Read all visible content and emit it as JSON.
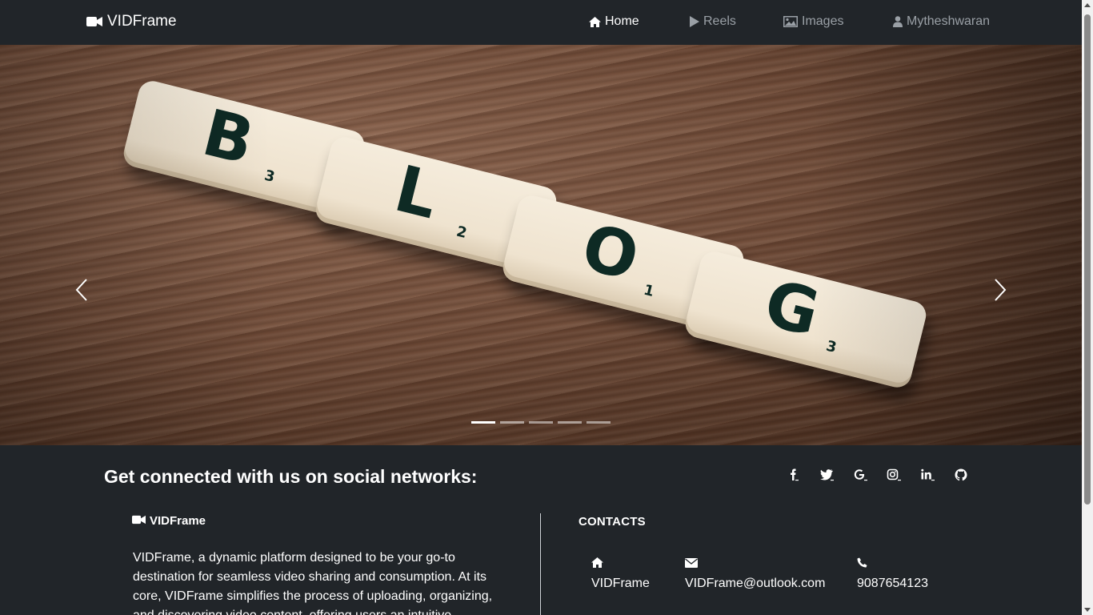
{
  "navbar": {
    "brand": "VIDFrame",
    "brand_icon": "video-camera-icon",
    "items": [
      {
        "label": "Home",
        "icon": "home-icon",
        "active": true
      },
      {
        "label": "Reels",
        "icon": "play-icon",
        "active": false
      },
      {
        "label": "Images",
        "icon": "image-icon",
        "active": false
      },
      {
        "label": "Mytheshwaran",
        "icon": "user-icon",
        "active": false
      }
    ]
  },
  "carousel": {
    "tiles": [
      {
        "letter": "B",
        "sub": "3"
      },
      {
        "letter": "L",
        "sub": "2"
      },
      {
        "letter": "O",
        "sub": "1"
      },
      {
        "letter": "G",
        "sub": "3"
      }
    ],
    "indicator_count": 5,
    "active_index": 0
  },
  "footer": {
    "social_title": "Get connected with us on social networks:",
    "social": [
      {
        "name": "facebook-icon",
        "glyph": "f"
      },
      {
        "name": "twitter-icon",
        "glyph": "t"
      },
      {
        "name": "google-icon",
        "glyph": "G"
      },
      {
        "name": "instagram-icon",
        "glyph": "◎"
      },
      {
        "name": "linkedin-icon",
        "glyph": "in"
      },
      {
        "name": "github-icon",
        "glyph": "●"
      }
    ],
    "brand": "VIDFrame",
    "about": "VIDFrame, a dynamic platform designed to be your go-to destination for seamless video sharing and consumption. At its core, VIDFrame simplifies the process of uploading, organizing, and discovering video content, offering users an intuitive",
    "contacts_head": "CONTACTS",
    "contacts": [
      {
        "icon": "home-icon",
        "text": "VIDFrame"
      },
      {
        "icon": "envelope-icon",
        "text": "VIDFrame@outlook.com"
      },
      {
        "icon": "phone-icon",
        "text": "9087654123"
      }
    ]
  },
  "colors": {
    "background": "#212529",
    "nav_inactive": "#9aa0a6",
    "text": "#ffffff"
  }
}
